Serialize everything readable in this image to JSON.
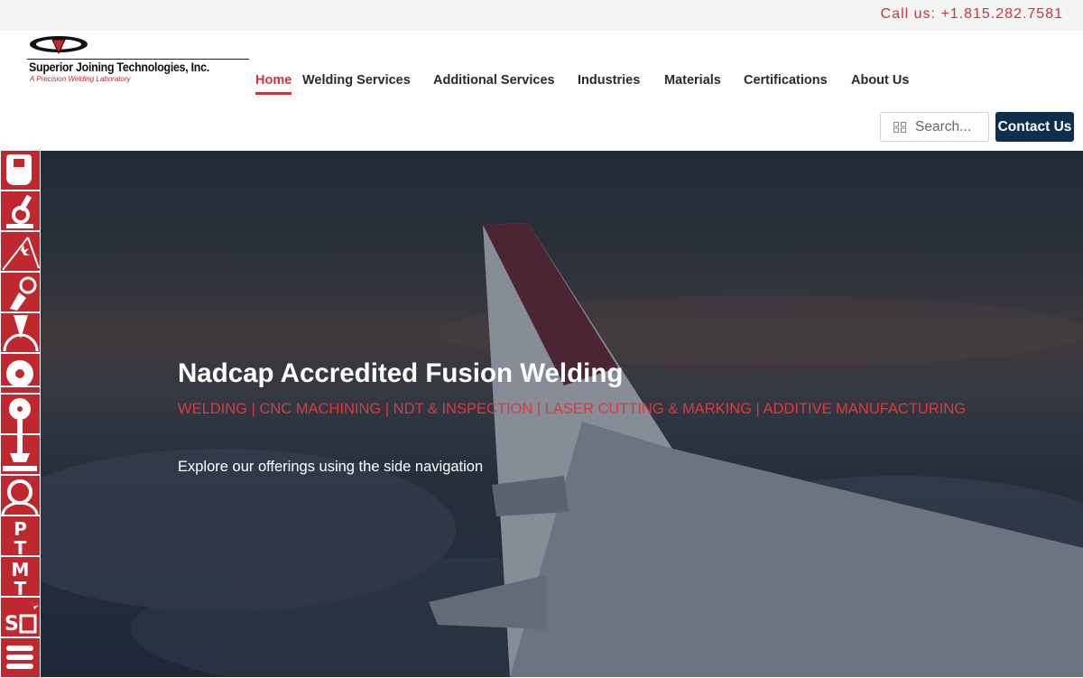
{
  "topbar": {
    "phone": "Call us: +1.815.282.7581"
  },
  "logo": {
    "company": "Superior Joining Technologies, Inc.",
    "tagline": "A Precision Welding Laboratory"
  },
  "nav": {
    "items": [
      {
        "label": "Home",
        "active": true
      },
      {
        "label": "Welding Services"
      },
      {
        "label": "Additional Services"
      },
      {
        "label": "Industries"
      },
      {
        "label": "Materials"
      },
      {
        "label": "Certifications"
      },
      {
        "label": "About Us"
      }
    ]
  },
  "search": {
    "placeholder": "Search..."
  },
  "contact": {
    "label": "Contact Us"
  },
  "sidebar": {
    "icons": [
      "welding-helmet-icon",
      "microscope-icon",
      "welding-spark-icon",
      "cutting-torch-icon",
      "weld-bead-icon",
      "grinding-wheel-icon",
      "drill-bit-icon",
      "machining-icon",
      "ring-inspection-icon",
      "pt-penetrant-testing-icon",
      "mt-magnetic-testing-icon",
      "spark-marking-icon",
      "additive-layers-icon",
      "laser-cut-icon"
    ],
    "pt_text": "PT",
    "mt_text": "MT"
  },
  "hero": {
    "title": "Nadcap Accredited Fusion Welding",
    "services": "WELDING | CNC MACHINING | NDT & INSPECTION | LASER CUTTING & MARKING | ADDITIVE MANUFACTURING",
    "explore": "Explore our offerings using the side navigation"
  },
  "colors": {
    "brand_red": "#c0282f",
    "accent_red": "#d0333b",
    "navy": "#0d2f4d"
  }
}
